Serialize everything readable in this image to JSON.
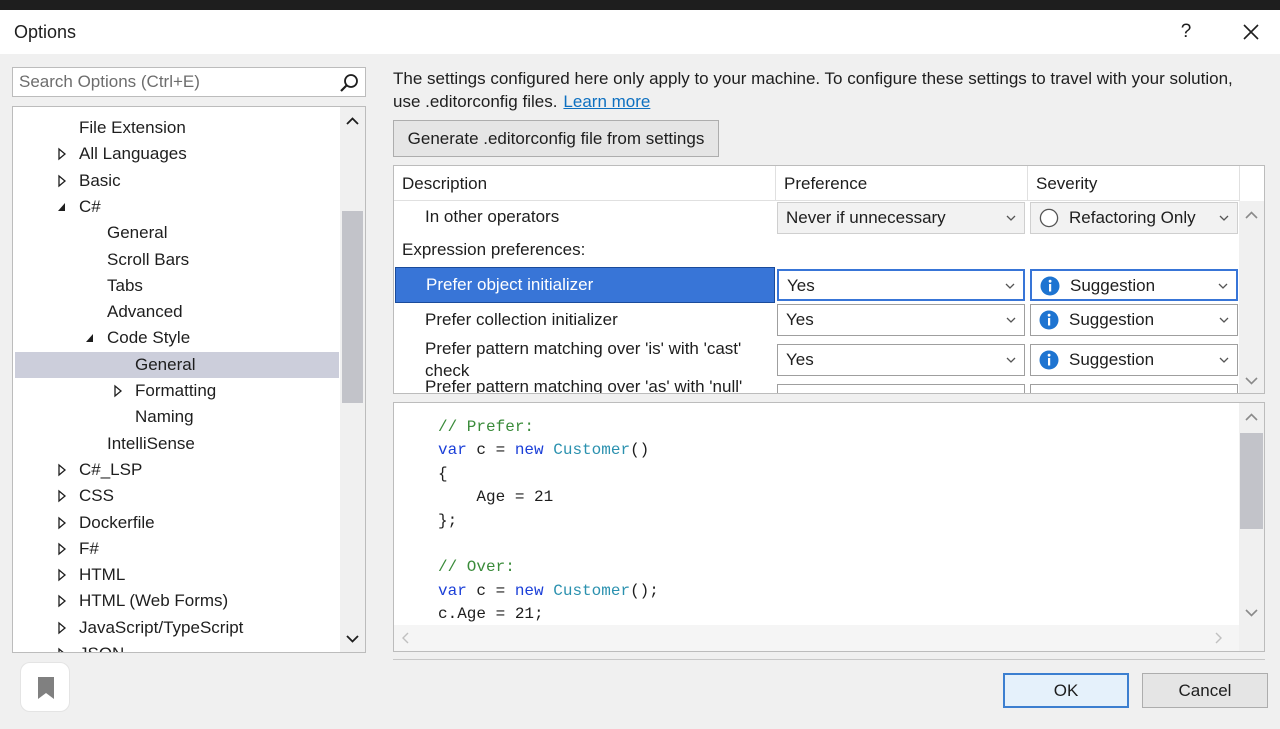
{
  "window": {
    "title": "Options",
    "help_label": "?"
  },
  "search": {
    "placeholder": "Search Options (Ctrl+E)",
    "value": ""
  },
  "tree": {
    "items": [
      {
        "label": "File Extension",
        "expander": "none"
      },
      {
        "label": "All Languages",
        "expander": "collapsed"
      },
      {
        "label": "Basic",
        "expander": "collapsed"
      },
      {
        "label": "C#",
        "expander": "expanded"
      },
      {
        "label": "General",
        "expander": "none"
      },
      {
        "label": "Scroll Bars",
        "expander": "none"
      },
      {
        "label": "Tabs",
        "expander": "none"
      },
      {
        "label": "Advanced",
        "expander": "none"
      },
      {
        "label": "Code Style",
        "expander": "expanded"
      },
      {
        "label": "General",
        "expander": "none",
        "selected": true
      },
      {
        "label": "Formatting",
        "expander": "collapsed"
      },
      {
        "label": "Naming",
        "expander": "none"
      },
      {
        "label": "IntelliSense",
        "expander": "none"
      },
      {
        "label": "C#_LSP",
        "expander": "collapsed"
      },
      {
        "label": "CSS",
        "expander": "collapsed"
      },
      {
        "label": "Dockerfile",
        "expander": "collapsed"
      },
      {
        "label": "F#",
        "expander": "collapsed"
      },
      {
        "label": "HTML",
        "expander": "collapsed"
      },
      {
        "label": "HTML (Web Forms)",
        "expander": "collapsed"
      },
      {
        "label": "JavaScript/TypeScript",
        "expander": "collapsed"
      },
      {
        "label": "JSON",
        "expander": "collapsed"
      }
    ]
  },
  "info": {
    "text": "The settings configured here only apply to your machine. To configure these settings to travel with your solution, use .editorconfig files.",
    "link": "Learn more"
  },
  "generate_button": "Generate .editorconfig file from settings",
  "grid": {
    "headers": [
      "Description",
      "Preference",
      "Severity"
    ],
    "rows": [
      {
        "kind": "setting",
        "description": "In other operators",
        "preference": "Never if unnecessary",
        "severity": "Refactoring Only",
        "severity_icon": "circle-outline-icon"
      },
      {
        "kind": "section",
        "description": "Expression preferences:"
      },
      {
        "kind": "setting",
        "description": "Prefer object initializer",
        "preference": "Yes",
        "severity": "Suggestion",
        "severity_icon": "info-icon",
        "selected": true
      },
      {
        "kind": "setting",
        "description": "Prefer collection initializer",
        "preference": "Yes",
        "severity": "Suggestion",
        "severity_icon": "info-icon"
      },
      {
        "kind": "setting",
        "description": "Prefer pattern matching over 'is' with 'cast' check",
        "preference": "Yes",
        "severity": "Suggestion",
        "severity_icon": "info-icon"
      },
      {
        "kind": "setting",
        "description": "Prefer pattern matching over 'as' with 'null' check",
        "preference": "",
        "severity": "",
        "severity_icon": ""
      }
    ]
  },
  "code_preview": {
    "lines": [
      [
        {
          "t": "// Prefer:",
          "c": "com"
        }
      ],
      [
        {
          "t": "var",
          "c": "kw"
        },
        {
          "t": " c = ",
          "c": "plain"
        },
        {
          "t": "new",
          "c": "kw"
        },
        {
          "t": " ",
          "c": "plain"
        },
        {
          "t": "Customer",
          "c": "type"
        },
        {
          "t": "()",
          "c": "plain"
        }
      ],
      [
        {
          "t": "{",
          "c": "plain"
        }
      ],
      [
        {
          "t": "    Age = 21",
          "c": "plain"
        }
      ],
      [
        {
          "t": "};",
          "c": "plain"
        }
      ],
      [
        {
          "t": "",
          "c": "plain"
        }
      ],
      [
        {
          "t": "// Over:",
          "c": "com"
        }
      ],
      [
        {
          "t": "var",
          "c": "kw"
        },
        {
          "t": " c = ",
          "c": "plain"
        },
        {
          "t": "new",
          "c": "kw"
        },
        {
          "t": " ",
          "c": "plain"
        },
        {
          "t": "Customer",
          "c": "type"
        },
        {
          "t": "();",
          "c": "plain"
        }
      ],
      [
        {
          "t": "c.Age = 21;",
          "c": "plain"
        }
      ]
    ]
  },
  "footer": {
    "ok": "OK",
    "cancel": "Cancel"
  },
  "colors": {
    "selection": "#3875d7",
    "tree_selection": "#cccedb",
    "link": "#0e70c0",
    "info_icon": "#1e74d1",
    "comment": "#3a8b3a",
    "keyword": "#1b3fd8",
    "type": "#2b91af"
  }
}
